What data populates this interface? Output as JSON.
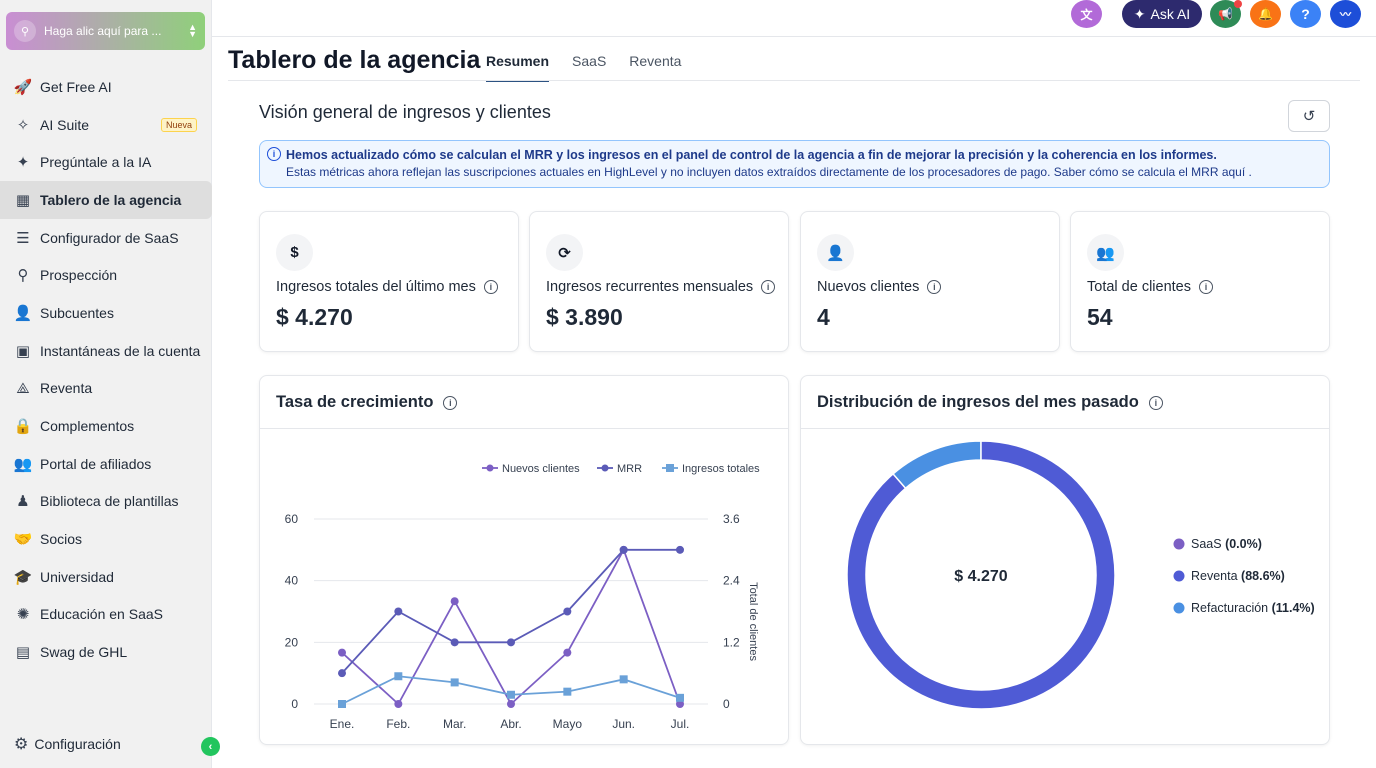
{
  "sidebar": {
    "location_button": "Haga alic aquí para ...",
    "items": [
      {
        "label": "Get Free AI",
        "icon": "rocket-icon",
        "glyph": "🚀"
      },
      {
        "label": "AI Suite",
        "icon": "sparkle-wand-icon",
        "glyph": "✧",
        "badge": "Nueva"
      },
      {
        "label": "Pregúntale a la IA",
        "icon": "sparkles-icon",
        "glyph": "✦"
      },
      {
        "label": "Tablero de la agencia",
        "icon": "dashboard-icon",
        "glyph": "▦",
        "active": true
      },
      {
        "label": "Configurador de SaaS",
        "icon": "chart-list-icon",
        "glyph": "☰"
      },
      {
        "label": "Prospección",
        "icon": "user-search-icon",
        "glyph": "⚲"
      },
      {
        "label": "Subcuentes",
        "icon": "user-icon",
        "glyph": "👤"
      },
      {
        "label": "Instantáneas de la cuenta",
        "icon": "snapshot-icon",
        "glyph": "▣"
      },
      {
        "label": "Reventa",
        "icon": "resell-icon",
        "glyph": "⟁"
      },
      {
        "label": "Complementos",
        "icon": "bag-icon",
        "glyph": "🔒"
      },
      {
        "label": "Portal de afiliados",
        "icon": "users-icon",
        "glyph": "👥"
      },
      {
        "label": "Biblioteca de plantillas",
        "icon": "library-icon",
        "glyph": "♟"
      },
      {
        "label": "Socios",
        "icon": "handshake-icon",
        "glyph": "🤝"
      },
      {
        "label": "Universidad",
        "icon": "graduation-cap-icon",
        "glyph": "🎓"
      },
      {
        "label": "Educación en SaaS",
        "icon": "brain-icon",
        "glyph": "✺"
      },
      {
        "label": "Swag de GHL",
        "icon": "store-icon",
        "glyph": "▤"
      }
    ],
    "settings_label": "Configuración"
  },
  "topbar": {
    "ask_ai": "Ask AI",
    "help": "?"
  },
  "header": {
    "title": "Tablero de la agencia",
    "tabs": [
      {
        "label": "Resumen",
        "active": true
      },
      {
        "label": "SaaS"
      },
      {
        "label": "Reventa"
      }
    ]
  },
  "section": {
    "title": "Visión general de ingresos y clientes"
  },
  "alert": {
    "line1": "Hemos actualizado cómo se calculan el MRR y los ingresos en el panel de control de la agencia a fin de mejorar la precisión y la coherencia en los informes.",
    "line2": "Estas métricas ahora reflejan las suscripciones actuales en HighLevel y no incluyen datos extraídos directamente de los procesadores de pago. Saber cómo se calcula el MRR aquí ."
  },
  "stats": [
    {
      "label": "Ingresos totales del último mes",
      "value": "$ 4.270",
      "icon": "dollar-icon",
      "glyph": "$"
    },
    {
      "label": "Ingresos recurrentes mensuales",
      "value": "$ 3.890",
      "icon": "recurring-icon",
      "glyph": "⟳"
    },
    {
      "label": "Nuevos clientes",
      "value": "4",
      "icon": "user-plus-icon",
      "glyph": "👤"
    },
    {
      "label": "Total de clientes",
      "value": "54",
      "icon": "users-icon",
      "glyph": "👥"
    }
  ],
  "growth_card": {
    "title": "Tasa de crecimiento"
  },
  "distribution_card": {
    "title": "Distribución de ingresos del mes pasado"
  },
  "colors": {
    "nuevos": "#7c5fc4",
    "mrr": "#5b5bb7",
    "ingresos": "#6aa1d8",
    "saas": "#7c5fc4",
    "reventa": "#4f5bd5",
    "refacturacion": "#4a90e2"
  },
  "chart_data": [
    {
      "type": "line",
      "title": "Tasa de crecimiento",
      "categories": [
        "Ene.",
        "Feb.",
        "Mar.",
        "Abr.",
        "Mayo",
        "Jun.",
        "Jul."
      ],
      "y_left_ticks": [
        "0",
        "20",
        "40",
        "60"
      ],
      "y_right_ticks": [
        "0",
        "1.2",
        "2.4",
        "3.6"
      ],
      "y_right_label": "Total de clientes",
      "ylim": [
        0,
        60
      ],
      "y2lim": [
        0,
        3.6
      ],
      "series": [
        {
          "name": "Nuevos clientes",
          "axis": "right",
          "marker": "circle",
          "values": [
            1.0,
            0,
            2.0,
            0,
            1.0,
            3.0,
            0
          ]
        },
        {
          "name": "MRR",
          "axis": "left",
          "marker": "circle",
          "values": [
            10,
            30,
            20,
            20,
            30,
            50,
            50
          ]
        },
        {
          "name": "Ingresos totales",
          "axis": "left",
          "marker": "square",
          "values": [
            0,
            9,
            7,
            3,
            4,
            8,
            2
          ]
        }
      ]
    },
    {
      "type": "pie",
      "title": "Distribución de ingresos del mes pasado",
      "center_label": "$ 4.270",
      "slices": [
        {
          "name": "SaaS",
          "pct_label": "(0.0%)",
          "value": 0.0
        },
        {
          "name": "Reventa",
          "pct_label": "(88.6%)",
          "value": 88.6
        },
        {
          "name": "Refacturación",
          "pct_label": "(11.4%)",
          "value": 11.4
        }
      ]
    }
  ]
}
